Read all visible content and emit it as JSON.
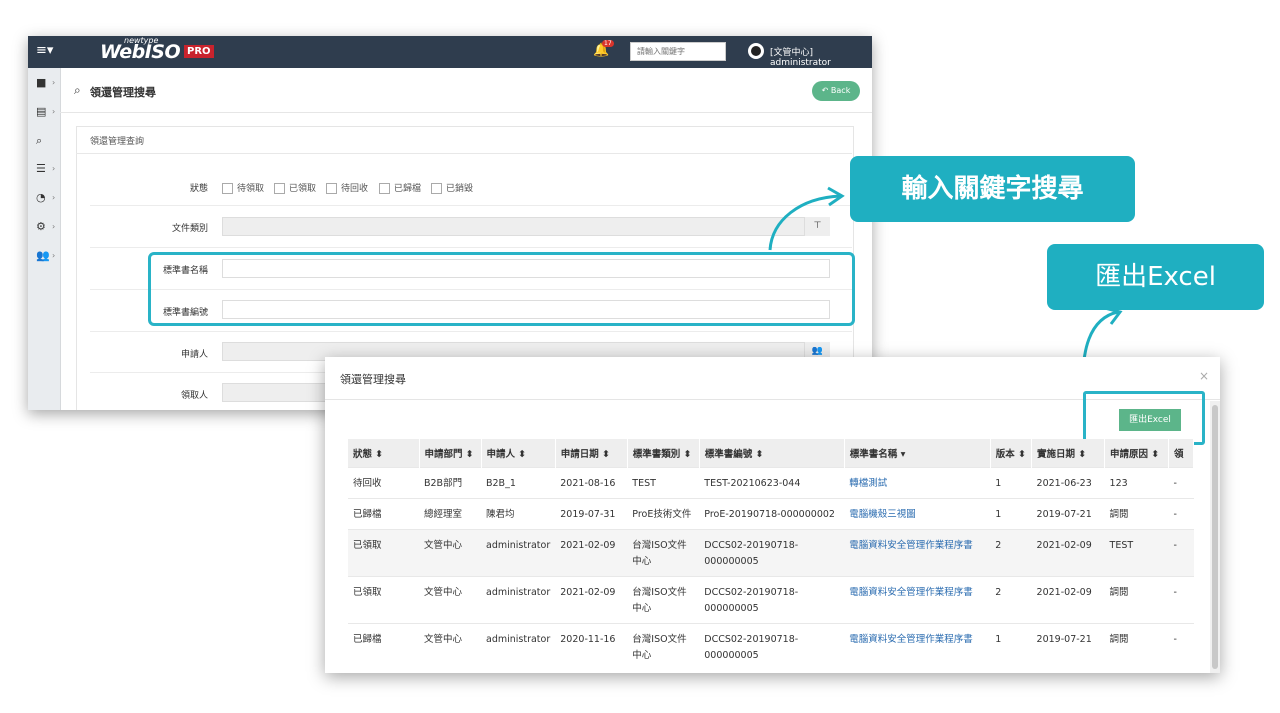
{
  "back_window": {
    "logo": {
      "top_word": "newtype",
      "main": "WebISO",
      "badge": "PRO"
    },
    "notification_count": "17",
    "search_placeholder": "請輸入關鍵字",
    "user_label": "[文管中心] administrator",
    "page_title": "領還管理搜尋",
    "back_label": "Back",
    "panel_title": "領還管理查詢",
    "status_label": "狀態",
    "status_options": [
      "待領取",
      "已領取",
      "待回收",
      "已歸檔",
      "已銷毀"
    ],
    "labels": {
      "doc_type": "文件類別",
      "std_name": "標準書名稱",
      "std_no": "標準書編號",
      "applicant": "申請人",
      "receiver": "領取人"
    }
  },
  "callouts": {
    "keyword": "輸入關鍵字搜尋",
    "excel": "匯出Excel"
  },
  "modal": {
    "title": "領還管理搜尋",
    "close": "×",
    "export_label": "匯出Excel",
    "columns": [
      "狀態 ⬍",
      "申請部門 ⬍",
      "申請人 ⬍",
      "申請日期 ⬍",
      "標準書類別 ⬍",
      "標準書編號 ⬍",
      "標準書名稱 ▾",
      "版本 ⬍",
      "實施日期 ⬍",
      "申請原因 ⬍",
      "領"
    ],
    "rows": [
      [
        "待回收",
        "B2B部門",
        "B2B_1",
        "2021-08-16",
        "TEST",
        "TEST-20210623-044",
        "轉檔測試",
        "1",
        "2021-06-23",
        "123",
        "-"
      ],
      [
        "已歸檔",
        "總經理室",
        "陳君均",
        "2019-07-31",
        "ProE技術文件",
        "ProE-20190718-000000002",
        "電腦機殼三視圖",
        "1",
        "2019-07-21",
        "調閱",
        "-"
      ],
      [
        "已領取",
        "文管中心",
        "administrator",
        "2021-02-09",
        "台灣ISO文件中心",
        "DCCS02-20190718-000000005",
        "電腦資料安全管理作業程序書",
        "2",
        "2021-02-09",
        "TEST",
        "-"
      ],
      [
        "已領取",
        "文管中心",
        "administrator",
        "2021-02-09",
        "台灣ISO文件中心",
        "DCCS02-20190718-000000005",
        "電腦資料安全管理作業程序書",
        "2",
        "2021-02-09",
        "調閱",
        "-"
      ],
      [
        "已歸檔",
        "文管中心",
        "administrator",
        "2020-11-16",
        "台灣ISO文件中心",
        "DCCS02-20190718-000000005",
        "電腦資料安全管理作業程序書",
        "1",
        "2019-07-21",
        "調閱",
        "-"
      ]
    ]
  }
}
